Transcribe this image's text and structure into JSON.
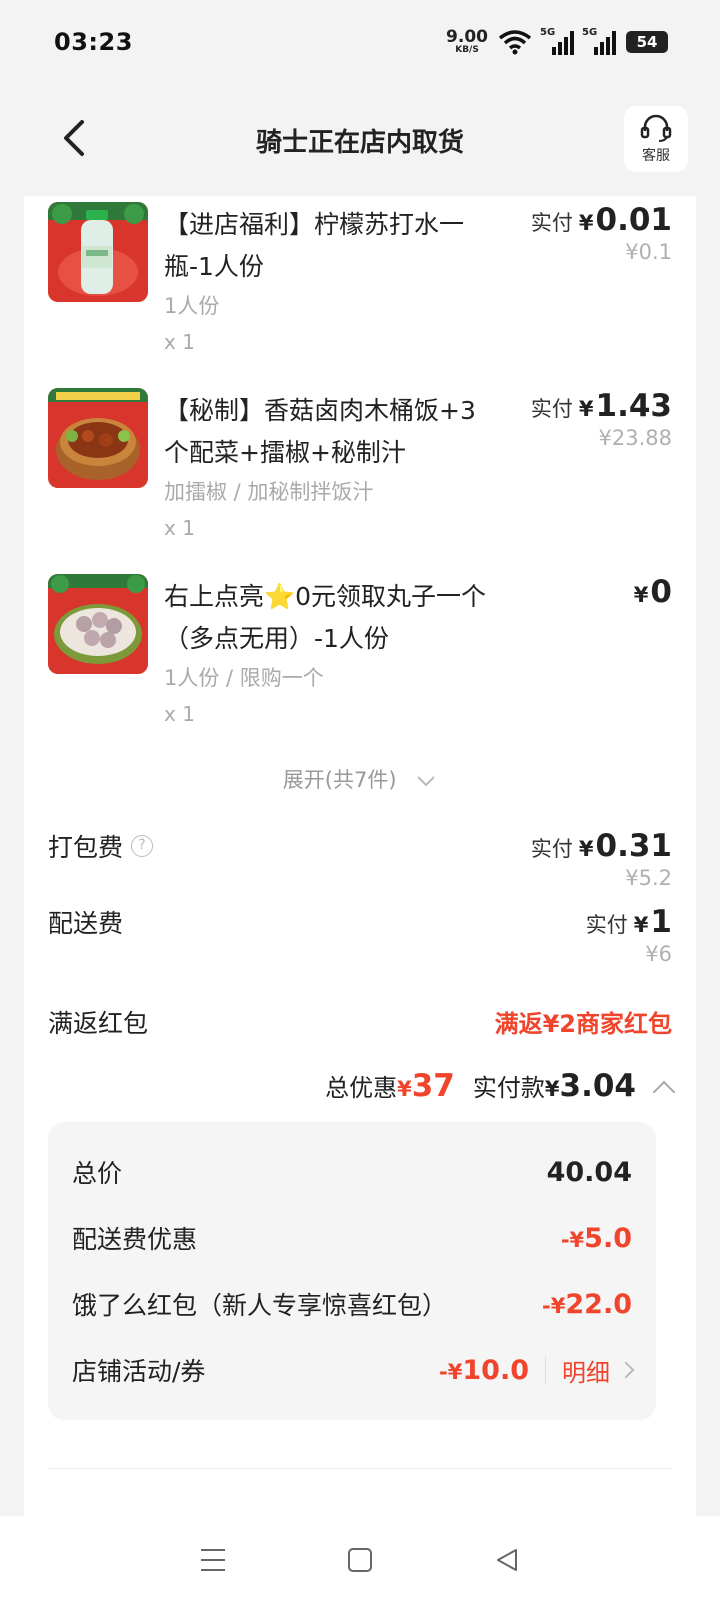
{
  "status_bar": {
    "time": "03:23",
    "net_speed": "9.00",
    "net_unit": "KB/S",
    "signal1": "5G",
    "signal2": "5G",
    "battery": "54"
  },
  "header": {
    "title": "骑士正在店内取货",
    "service_label": "客服"
  },
  "items": [
    {
      "name": "【进店福利】柠檬苏打水一瓶-1人份",
      "spec": "1人份",
      "qty": "x 1",
      "pay_label": "实付",
      "currency": "¥",
      "paid": "0.01",
      "original": "¥0.1"
    },
    {
      "name": "【秘制】香菇卤肉木桶饭+3个配菜+擂椒+秘制汁",
      "spec": "加擂椒 / 加秘制拌饭汁",
      "qty": "x 1",
      "pay_label": "实付",
      "currency": "¥",
      "paid": "1.43",
      "original": "¥23.88"
    },
    {
      "name": "右上点亮⭐0元领取丸子一个（多点无用）-1人份",
      "spec": "1人份 / 限购一个",
      "qty": "x 1",
      "pay_label": "",
      "currency": "¥",
      "paid": "0",
      "original": ""
    }
  ],
  "expand_label": "展开(共7件)",
  "fees": {
    "packing": {
      "label": "打包费",
      "pay_label": "实付",
      "currency": "¥",
      "paid": "0.31",
      "original": "¥5.2"
    },
    "delivery": {
      "label": "配送费",
      "pay_label": "实付",
      "currency": "¥",
      "paid": "1",
      "original": "¥6"
    },
    "red_packet": {
      "label": "满返红包",
      "value": "满返¥2商家红包"
    }
  },
  "summary": {
    "discount_label": "总优惠",
    "currency": "¥",
    "discount": "37",
    "paid_label": "实付款",
    "paid": "3.04"
  },
  "breakdown": {
    "total": {
      "label": "总价",
      "value": "40.04"
    },
    "delivery_discount": {
      "label": "配送费优惠",
      "prefix": "-¥",
      "value": "5.0"
    },
    "eleme_packet": {
      "label": "饿了么红包（新人专享惊喜红包）",
      "prefix": "-¥",
      "value": "22.0"
    },
    "shop": {
      "label": "店铺活动/券",
      "prefix": "-¥",
      "value": "10.0",
      "link": "明细"
    }
  },
  "colors": {
    "accent_red": "#f0442c",
    "background": "#f3f3f3"
  }
}
